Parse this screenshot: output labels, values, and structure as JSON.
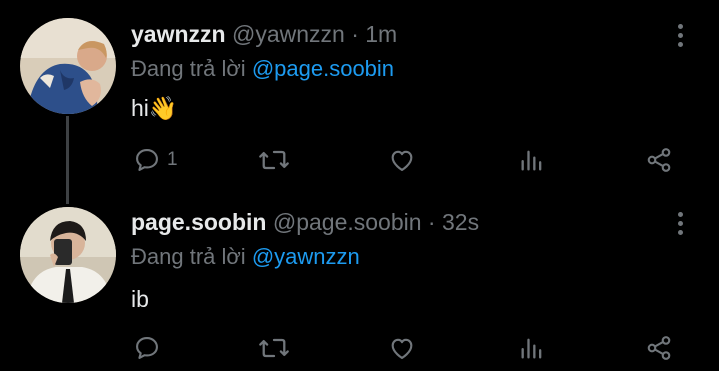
{
  "tweets": [
    {
      "name": "yawnzzn",
      "handle": "@yawnzzn",
      "separator": "·",
      "time": "1m",
      "reply_prefix": "Đang trả lời",
      "reply_to": "@page.soobin",
      "text": "hi👋",
      "replies": "1",
      "avatar_icon": "avatar-photo"
    },
    {
      "name": "page.soobin",
      "handle": "@page.soobin",
      "separator": "·",
      "time": "32s",
      "reply_prefix": "Đang trả lời",
      "reply_to": "@yawnzzn",
      "text": "ib",
      "replies": "",
      "avatar_icon": "avatar-photo"
    }
  ],
  "icons": {
    "more": "more-vertical-icon",
    "reply": "comment-icon",
    "retweet": "retweet-icon",
    "like": "heart-icon",
    "stats": "analytics-icon",
    "share": "share-icon"
  },
  "colors": {
    "background": "#000000",
    "text": "#e7e9ea",
    "muted": "#71767b",
    "link": "#1d9bf0",
    "thread_line": "#3e4144"
  }
}
